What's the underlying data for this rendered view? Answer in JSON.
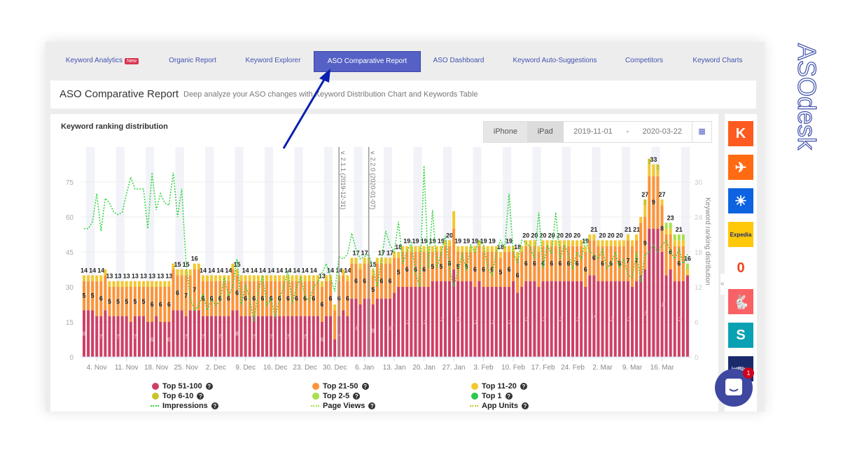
{
  "nav": {
    "tabs": [
      {
        "label": "Keyword Analytics",
        "badge": "New"
      },
      {
        "label": "Organic Report"
      },
      {
        "label": "Keyword Explorer"
      },
      {
        "label": "ASO Comparative Report"
      },
      {
        "label": "ASO Dashboard"
      },
      {
        "label": "Keyword Auto-Suggestions"
      },
      {
        "label": "Competitors"
      },
      {
        "label": "Keyword Charts"
      }
    ],
    "active": "ASO Comparative Report"
  },
  "header": {
    "title": "ASO Comparative Report",
    "subtitle": "Deep analyze your ASO changes with Keyword Distribution Chart and Keywords Table"
  },
  "card": {
    "title": "Keyword ranking distribution",
    "devices": [
      "iPhone",
      "iPad"
    ],
    "date_from": "2019-11-01",
    "date_sep": "-",
    "date_to": "2020-03-22",
    "calendar_icon": "calendar-icon"
  },
  "brand": {
    "logo": "ASOdesk",
    "color": "#3d4fa8"
  },
  "sidebar": {
    "apps": [
      {
        "name": "Kayak",
        "glyph": "K",
        "color": "#ff5a1f"
      },
      {
        "name": "plane",
        "glyph": "✈",
        "color": "#ff6a13"
      },
      {
        "name": "sunrise",
        "glyph": "☀",
        "color": "#0d63e0"
      },
      {
        "name": "Expedia",
        "glyph": "Expedia",
        "color": "#ffc80a"
      },
      {
        "name": "luggage",
        "glyph": "0",
        "color": "#ffffff"
      },
      {
        "name": "Hopper",
        "glyph": "🐇",
        "color": "#fa6164"
      },
      {
        "name": "Skyscanner",
        "glyph": "S",
        "color": "#0aa1b3"
      },
      {
        "name": "jetBlue",
        "glyph": "jetBlue",
        "color": "#1b2a6b"
      }
    ],
    "collapse_icon": "«"
  },
  "chat": {
    "badge": "1"
  },
  "colors": {
    "top51_100": "#cf3f64",
    "top21_50": "#fd9336",
    "top11_20": "#f2c82f",
    "top6_10": "#c9c32c",
    "top2_5": "#a7e04a",
    "top1": "#2cc84f",
    "impressions": "#2fd43d",
    "page_views": "#a7e04a",
    "app_units": "#c9c32c",
    "accent": "#5661c5"
  },
  "chart_data": {
    "type": "bar",
    "stacked": true,
    "x_start": "2019-11-01",
    "x_end": "2020-03-22",
    "x_ticks": [
      "4. Nov",
      "11. Nov",
      "18. Nov",
      "25. Nov",
      "2. Dec",
      "9. Dec",
      "16. Dec",
      "23. Dec",
      "30. Dec",
      "6. Jan",
      "13. Jan",
      "20. Jan",
      "27. Jan",
      "3. Feb",
      "10. Feb",
      "17. Feb",
      "24. Feb",
      "2. Mar",
      "9. Mar",
      "16. Mar"
    ],
    "y_left": {
      "ticks": [
        0,
        15,
        30,
        45,
        60,
        75
      ],
      "range": [
        0,
        90
      ]
    },
    "y_right": {
      "label": "Keyword ranking distribution",
      "ticks": [
        0,
        6,
        12,
        18,
        24,
        30
      ],
      "range": [
        0,
        36
      ]
    },
    "plot_lines": [
      {
        "label": "v. 2.1.1 (2019-12-31)",
        "date": "2019-12-31"
      },
      {
        "label": "v. 2.2.0 (2020-01-07)",
        "date": "2020-01-07"
      }
    ],
    "legend": [
      {
        "name": "Top 51-100",
        "kind": "bar"
      },
      {
        "name": "Top 21-50",
        "kind": "bar"
      },
      {
        "name": "Top 11-20",
        "kind": "bar"
      },
      {
        "name": "Top 6-10",
        "kind": "bar"
      },
      {
        "name": "Top 2-5",
        "kind": "bar"
      },
      {
        "name": "Top 1",
        "kind": "bar"
      },
      {
        "name": "Impressions",
        "kind": "line"
      },
      {
        "name": "Page Views",
        "kind": "line"
      },
      {
        "name": "App Units",
        "kind": "line"
      }
    ],
    "series": [
      {
        "name": "Top 51-100",
        "axis": "right",
        "values": [
          8,
          8,
          8,
          7,
          7,
          8,
          7,
          7,
          7,
          7,
          7,
          6,
          7,
          7,
          7,
          6,
          6,
          7,
          6,
          6,
          6,
          8,
          8,
          8,
          7,
          8,
          8,
          8,
          7,
          7,
          7,
          7,
          7,
          7,
          7,
          8,
          8,
          7,
          7,
          7,
          7,
          7,
          7,
          7,
          7,
          7,
          7,
          7,
          7,
          7,
          7,
          7,
          7,
          7,
          7,
          7,
          6,
          7,
          7,
          3,
          7,
          8,
          7,
          10,
          10,
          9,
          10,
          10,
          9,
          10,
          10,
          10,
          10,
          11,
          12,
          12,
          12,
          12,
          12,
          12,
          12,
          12,
          13,
          13,
          13,
          13,
          13,
          15,
          13,
          13,
          13,
          13,
          12,
          13,
          12,
          12,
          12,
          12,
          12,
          12,
          12,
          13,
          11,
          12,
          13,
          13,
          13,
          12,
          13,
          13,
          13,
          13,
          13,
          13,
          13,
          13,
          13,
          13,
          12,
          14,
          14,
          13,
          13,
          13,
          13,
          13,
          13,
          13,
          13,
          12,
          13,
          14,
          15,
          22,
          22,
          22,
          18,
          14,
          15,
          13,
          13,
          13,
          14
        ]
      },
      {
        "name": "Top 21-50",
        "axis": "right",
        "values": [
          5,
          5,
          5,
          6,
          6,
          6,
          5,
          5,
          5,
          5,
          5,
          6,
          5,
          5,
          5,
          6,
          6,
          5,
          6,
          6,
          6,
          7,
          6,
          6,
          7,
          6,
          7,
          7,
          6,
          6,
          6,
          6,
          6,
          6,
          6,
          7,
          6,
          6,
          6,
          6,
          6,
          6,
          6,
          6,
          6,
          6,
          6,
          6,
          6,
          6,
          6,
          6,
          6,
          6,
          6,
          6,
          6,
          6,
          6,
          5,
          6,
          6,
          6,
          6,
          6,
          6,
          6,
          6,
          5,
          6,
          6,
          6,
          6,
          6,
          5,
          6,
          6,
          6,
          6,
          6,
          6,
          6,
          5,
          5,
          5,
          6,
          6,
          7,
          5,
          5,
          5,
          5,
          6,
          6,
          6,
          6,
          6,
          6,
          5,
          6,
          6,
          5,
          6,
          6,
          6,
          6,
          6,
          6,
          6,
          6,
          6,
          6,
          6,
          6,
          6,
          6,
          6,
          6,
          6,
          6,
          6,
          6,
          6,
          6,
          6,
          6,
          6,
          6,
          7,
          7,
          7,
          9,
          9,
          9,
          9,
          9,
          8,
          7,
          6,
          6,
          6,
          6
        ]
      },
      {
        "name": "Top 11-20",
        "axis": "right",
        "values": [
          1,
          1,
          1,
          1,
          1,
          1,
          1,
          1,
          1,
          1,
          1,
          1,
          1,
          1,
          1,
          1,
          1,
          1,
          1,
          1,
          1,
          1,
          1,
          1,
          1,
          1,
          1,
          1,
          1,
          1,
          1,
          1,
          1,
          1,
          1,
          1,
          1,
          1,
          1,
          1,
          1,
          1,
          1,
          1,
          1,
          1,
          1,
          1,
          1,
          1,
          1,
          1,
          1,
          1,
          1,
          1,
          1,
          1,
          1,
          1,
          1,
          1,
          1,
          1,
          1,
          1,
          1,
          1,
          1,
          1,
          1,
          1,
          1,
          1,
          1,
          1,
          1,
          1,
          1,
          1,
          1,
          1,
          1,
          1,
          1,
          1,
          1,
          3,
          1,
          1,
          1,
          1,
          1,
          1,
          1,
          1,
          1,
          1,
          1,
          1,
          1,
          1,
          1,
          1,
          1,
          1,
          1,
          1,
          1,
          1,
          1,
          1,
          1,
          1,
          1,
          1,
          1,
          1,
          1,
          1,
          1,
          1,
          1,
          1,
          1,
          1,
          1,
          1,
          1,
          1,
          1,
          1,
          2,
          2,
          2,
          1,
          1,
          1,
          1,
          1,
          1,
          1,
          1
        ]
      },
      {
        "name": "Top 6-10",
        "axis": "right",
        "values": [
          0,
          0,
          0,
          0,
          0,
          0,
          0,
          0,
          0,
          0,
          0,
          0,
          0,
          0,
          0,
          0,
          0,
          0,
          0,
          0,
          0,
          0,
          0,
          0,
          0,
          0,
          0,
          0,
          0,
          0,
          0,
          0,
          0,
          0,
          0,
          0,
          0,
          0,
          0,
          0,
          0,
          0,
          0,
          0,
          0,
          0,
          0,
          0,
          0,
          0,
          0,
          0,
          0,
          0,
          0,
          0,
          0,
          0,
          0,
          0,
          0,
          0,
          0,
          0,
          0,
          0,
          0,
          0,
          0,
          0,
          0,
          0,
          0,
          0,
          0,
          0,
          0,
          0,
          0,
          0,
          0,
          0,
          0,
          0,
          0,
          0,
          0,
          0,
          0,
          0,
          0,
          0,
          0,
          0,
          0,
          0,
          0,
          0,
          0,
          0,
          0,
          0,
          0,
          0,
          0,
          0,
          0,
          0,
          0,
          0,
          0,
          0,
          0,
          0,
          0,
          0,
          0,
          0,
          0,
          0,
          0,
          0,
          0,
          0,
          0,
          0,
          0,
          0,
          0,
          0,
          0,
          0,
          1,
          1,
          0,
          1,
          0,
          0,
          0,
          0,
          0,
          0,
          0
        ]
      },
      {
        "name": "Top 2-5",
        "axis": "right",
        "values": [
          0,
          0,
          0,
          0,
          0,
          0,
          0,
          0,
          0,
          0,
          0,
          0,
          0,
          0,
          0,
          0,
          0,
          0,
          0,
          0,
          0,
          0,
          0,
          0,
          0,
          0,
          0,
          0,
          0,
          0,
          0,
          0,
          0,
          0,
          0,
          0,
          0,
          0,
          0,
          0,
          0,
          0,
          0,
          0,
          0,
          0,
          0,
          0,
          0,
          0,
          0,
          0,
          0,
          0,
          0,
          0,
          0,
          0,
          0,
          0,
          0,
          0,
          0,
          0,
          0,
          0,
          0,
          0,
          0,
          0,
          0,
          0,
          0,
          0,
          0,
          0,
          0,
          0,
          0,
          0,
          0,
          0,
          0,
          0,
          0,
          0,
          0,
          0,
          0,
          0,
          0,
          0,
          0,
          0,
          0,
          0,
          0,
          0,
          0,
          0,
          0,
          0,
          0,
          0,
          0,
          0,
          0,
          0,
          0,
          0,
          0,
          0,
          0,
          0,
          0,
          0,
          0,
          0,
          0,
          0,
          0,
          0,
          0,
          0,
          0,
          0,
          0,
          0,
          0,
          0,
          0,
          0,
          0,
          0,
          0,
          0,
          0,
          1,
          1,
          1,
          1,
          1,
          1
        ]
      },
      {
        "name": "Impressions",
        "axis": "left",
        "type": "line",
        "values": [
          55,
          55,
          58,
          70,
          54,
          68,
          66,
          62,
          61,
          62,
          70,
          77,
          72,
          72,
          72,
          55,
          79,
          63,
          70,
          66,
          65,
          79,
          60,
          72,
          40,
          25,
          20,
          22,
          27,
          20,
          25,
          22,
          24,
          34,
          26,
          30,
          42,
          22,
          31,
          25,
          15,
          28,
          35,
          22,
          25,
          17,
          25,
          30,
          37,
          23,
          30,
          34,
          26,
          24,
          30,
          32,
          36,
          40,
          34,
          28,
          43,
          42,
          44,
          53,
          46,
          42,
          43,
          44,
          38,
          30,
          42,
          54,
          48,
          45,
          58,
          40,
          45,
          49,
          36,
          30,
          82,
          38,
          63,
          38,
          44,
          52,
          38,
          30,
          37,
          44,
          37,
          48,
          45,
          50,
          48,
          38,
          35,
          45,
          50,
          47,
          70,
          45,
          40,
          50,
          49,
          47,
          42,
          62,
          38,
          48,
          44,
          62,
          42,
          48,
          44,
          38,
          45,
          42,
          50,
          45,
          44,
          42,
          46,
          38,
          40,
          45,
          38,
          42,
          35,
          34,
          45,
          32,
          44,
          45,
          48,
          45,
          48,
          50,
          45,
          42,
          46,
          40,
          44
        ]
      }
    ]
  }
}
